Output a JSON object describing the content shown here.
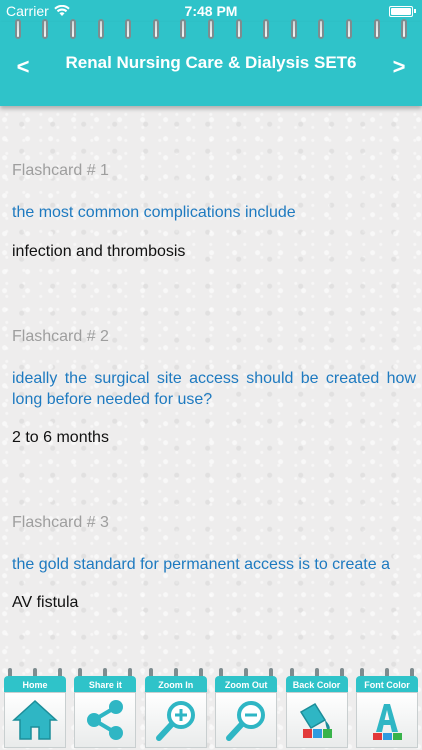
{
  "status_bar": {
    "carrier": "Carrier",
    "time": "7:48 PM",
    "battery_level": 1.0
  },
  "header": {
    "title": "Renal Nursing Care & Dialysis SET6",
    "prev_label": "<",
    "next_label": ">"
  },
  "cards": [
    {
      "number": "Flashcard # 1",
      "question": "the most common complications include",
      "answer": "infection and thrombosis"
    },
    {
      "number": "Flashcard # 2",
      "question": "ideally the surgical site access should be created how long before needed for use?",
      "answer": "2 to 6 months"
    },
    {
      "number": "Flashcard # 3",
      "question": "the gold standard for permanent access is to create a",
      "answer": "AV fistula"
    }
  ],
  "toolbar": {
    "home": "Home",
    "share": "Share it",
    "zoom_in": "Zoom In",
    "zoom_out": "Zoom Out",
    "back_color": "Back Color",
    "font_color": "Font Color"
  },
  "colors": {
    "accent": "#2fc3c9",
    "question_text": "#1e7ac0",
    "number_text": "#9e9e9e",
    "answer_text": "#111111"
  }
}
